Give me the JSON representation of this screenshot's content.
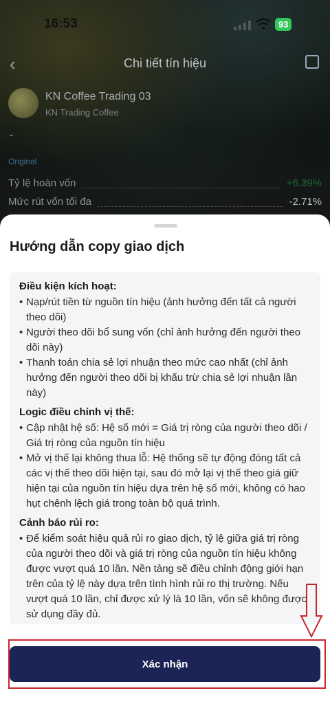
{
  "status_bar": {
    "time": "16:53",
    "battery": "93"
  },
  "nav": {
    "title": "Chi tiết tín hiệu"
  },
  "provider": {
    "name": "KN Coffee Trading 03",
    "sub": "KN Trading Coffee",
    "dash": "-"
  },
  "tag": "Original",
  "stats": [
    {
      "label": "Tỷ lệ hoàn vốn",
      "value": "+6.39%"
    },
    {
      "label": "Mức rút vốn tối đa",
      "value": "-2.71%"
    }
  ],
  "sheet": {
    "title": "Hướng dẫn copy giao dịch",
    "sections": [
      {
        "heading": "Điều kiện kích hoạt:",
        "items": [
          "Nạp/rút tiền từ nguồn tín hiệu (ảnh hưởng đến tất cả người theo dõi)",
          "Người theo dõi bổ sung vốn (chỉ ảnh hưởng đến người theo dõi này)",
          "Thanh toán chia sẻ lợi nhuận theo mức cao nhất (chỉ ảnh hưởng đến người theo dõi bị khấu trừ chia sẻ lợi nhuận lần này)"
        ]
      },
      {
        "heading": "Logic điều chỉnh vị thế:",
        "items": [
          "Cập nhật hệ số: Hệ số mới = Giá trị ròng của người theo dõi / Giá trị ròng của nguồn tín hiệu",
          "Mở vị thế lại không thua lỗ: Hệ thống sẽ tự động đóng tất cả các vị thế theo dõi hiện tại, sau đó mở lại vị thế theo giá giữ hiện tại của nguồn tín hiệu dựa trên hệ số mới, không có hao hụt chênh lệch giá trong toàn bộ quá trình."
        ]
      },
      {
        "heading": "Cảnh báo rủi ro:",
        "items": [
          "Để kiểm soát hiệu quả rủi ro giao dịch, tỷ lệ giữa giá trị ròng của người theo dõi và giá trị ròng của nguồn tín hiệu không được vượt quá 10 lần. Nền tảng sẽ điều chỉnh động giới hạn trên của tỷ lệ này dựa trên tình hình rủi ro thị trường. Nếu vượt quá 10 lần, chỉ được xử lý là 10 lần, vốn sẽ không được sử dụng đầy đủ."
        ]
      }
    ],
    "confirm_label": "Xác nhận"
  },
  "colors": {
    "button": "#1b2454",
    "highlight": "#c9262b",
    "positive": "#1c6b3a",
    "battery": "#33c759"
  }
}
